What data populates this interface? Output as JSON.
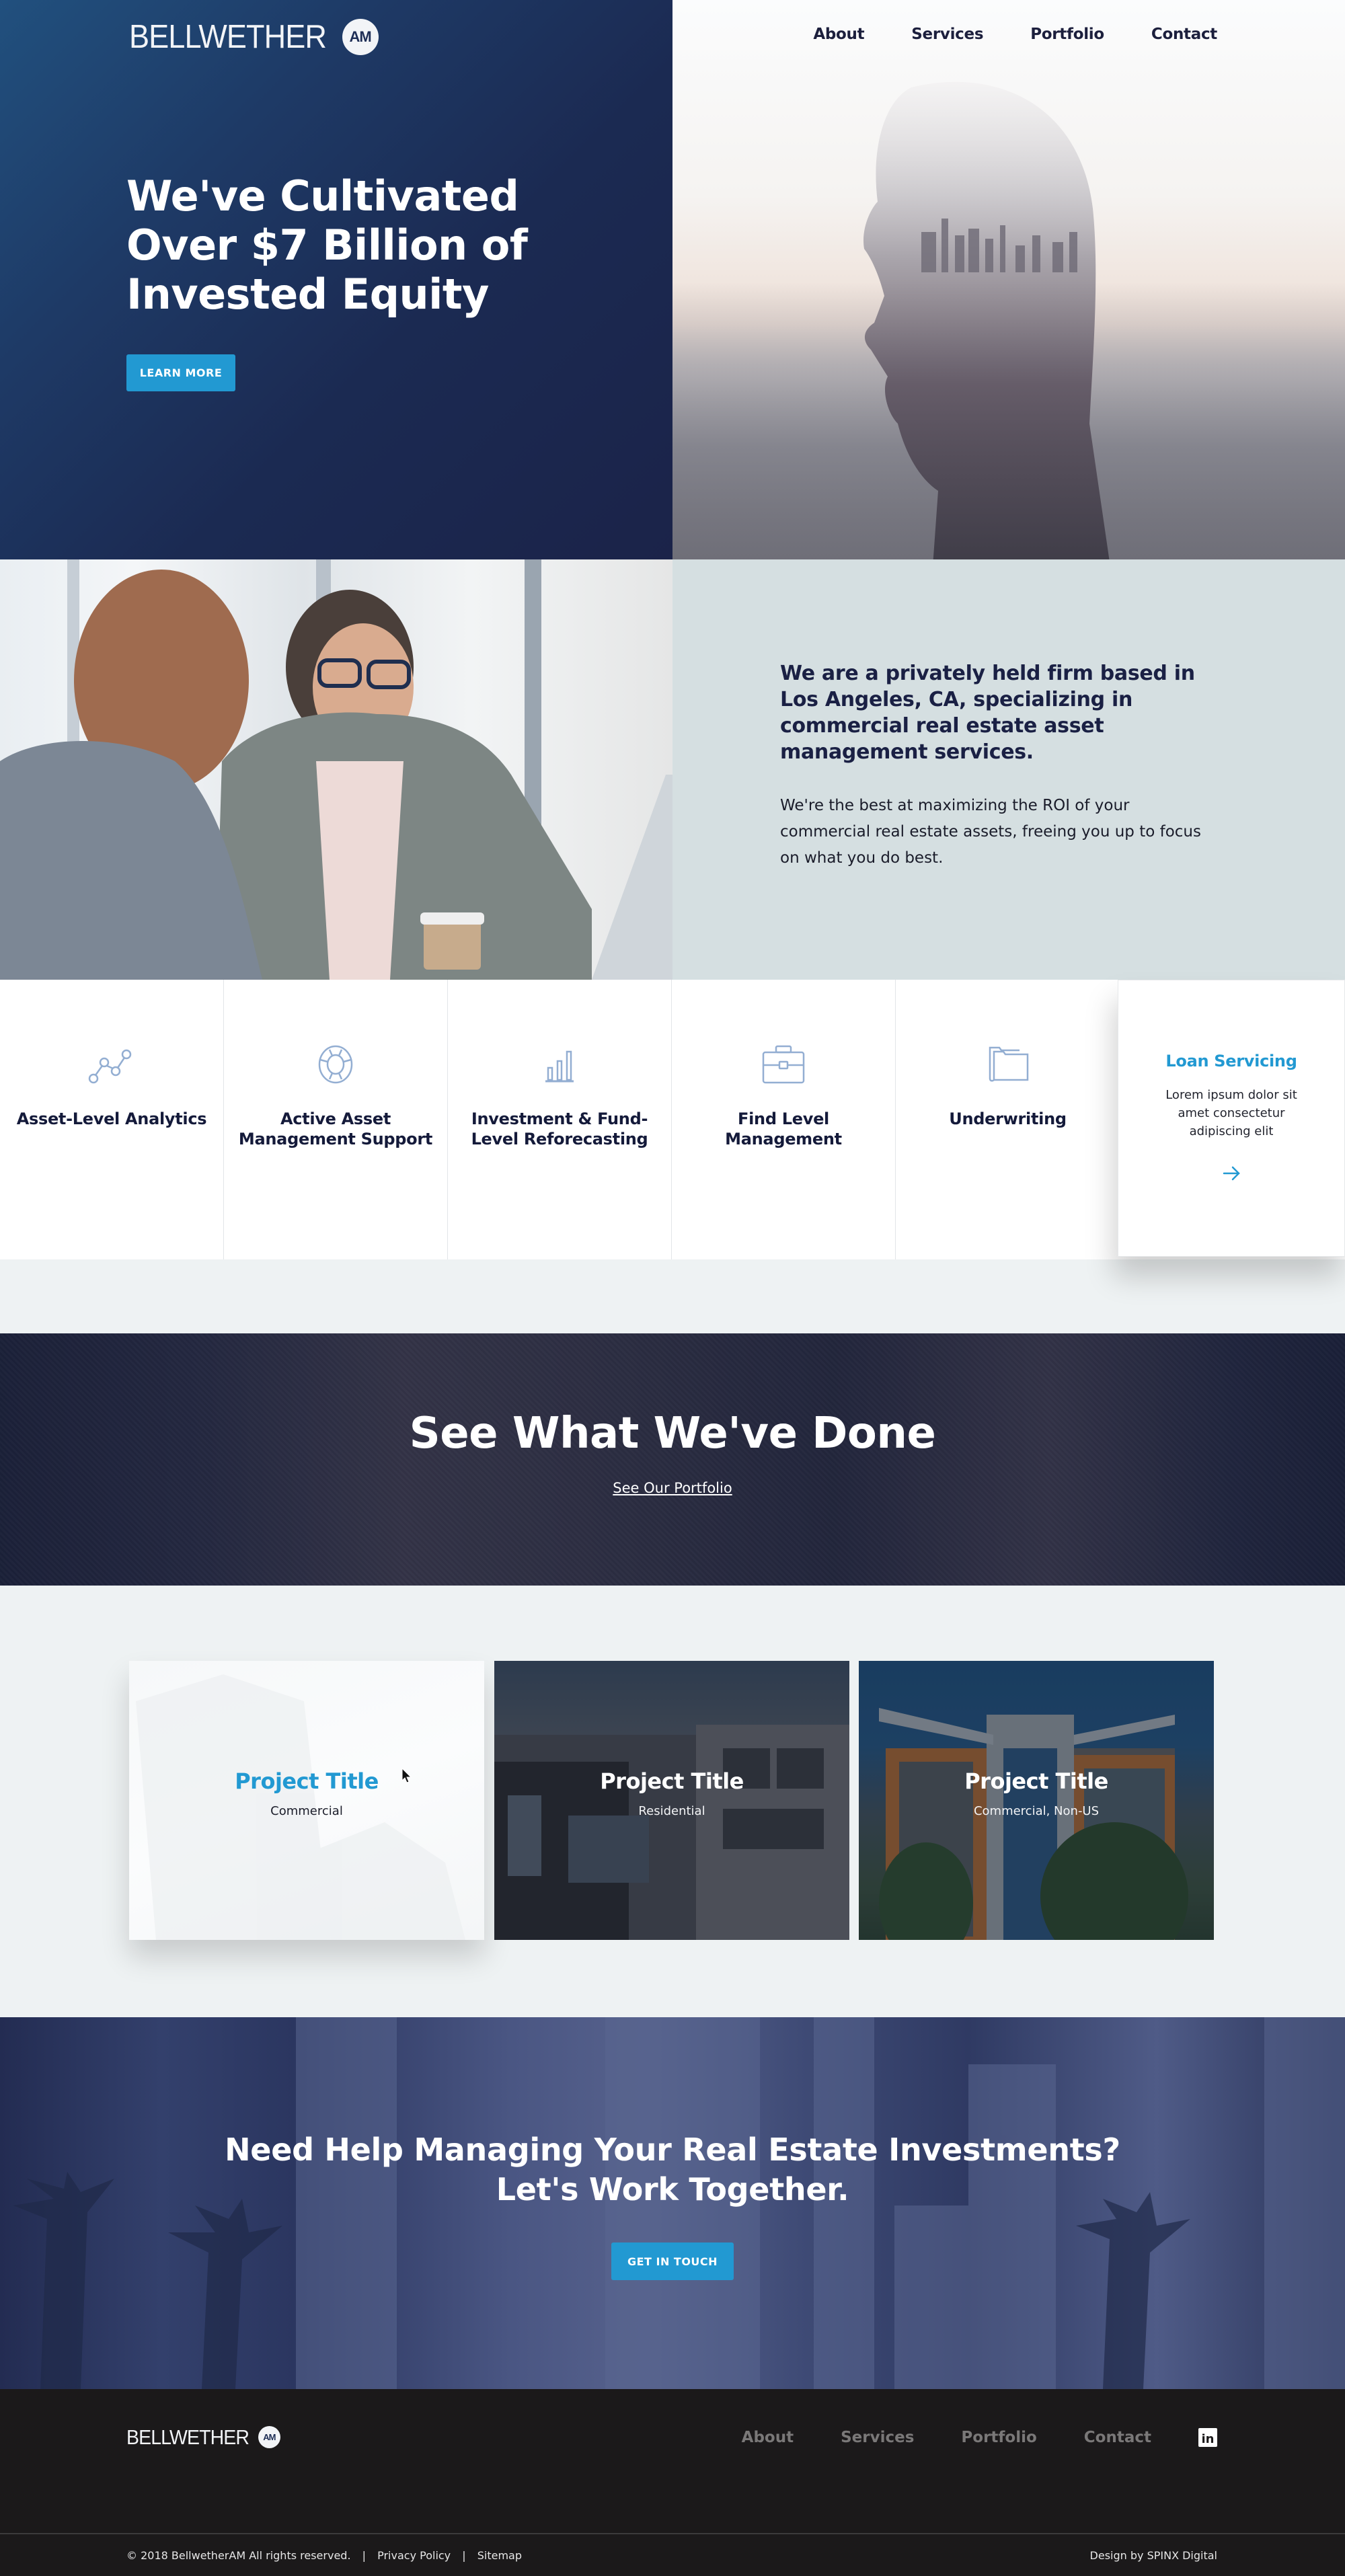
{
  "brand": {
    "name": "BELLWETHER",
    "badge": "AM"
  },
  "nav": {
    "items": [
      "About",
      "Services",
      "Portfolio",
      "Contact"
    ]
  },
  "hero": {
    "title": "We've Cultivated Over $7 Billion of Invested Equity",
    "cta_label": "LEARN MORE"
  },
  "about": {
    "heading": "We are a privately held firm based in Los Angeles, CA, specializing in commercial real estate asset management services.",
    "body": "We're the best at maximizing the ROI of your commercial real estate assets, freeing you up to focus on what you do best."
  },
  "services": {
    "items": [
      {
        "title": "Asset-Level Analytics",
        "icon": "analytics-line-icon"
      },
      {
        "title": "Active Asset Management Support",
        "icon": "lifebuoy-icon"
      },
      {
        "title": "Investment & Fund-Level Reforecasting",
        "icon": "bar-chart-icon"
      },
      {
        "title": "Find Level Management",
        "icon": "briefcase-icon"
      },
      {
        "title": "Underwriting",
        "icon": "folders-icon"
      }
    ],
    "active": {
      "title": "Loan Servicing",
      "description": "Lorem ipsum dolor sit amet consectetur adipiscing elit",
      "icon": "arrow-right-icon"
    }
  },
  "portfolio_banner": {
    "title": "See What We've Done",
    "link_label": "See Our Portfolio"
  },
  "projects": [
    {
      "title": "Project Title",
      "category": "Commercial"
    },
    {
      "title": "Project Title",
      "category": "Residential"
    },
    {
      "title": "Project Title",
      "category": "Commercial, Non-US"
    }
  ],
  "cta": {
    "title_line1": "Need Help Managing Your Real Estate Investments?",
    "title_line2": "Let's Work Together.",
    "button_label": "GET IN TOUCH"
  },
  "footer": {
    "nav": [
      "About",
      "Services",
      "Portfolio",
      "Contact"
    ],
    "social_icon": "linkedin-icon",
    "social_label": "in",
    "copyright": "© 2018 BellwetherAM All rights reserved.",
    "links": [
      "Privacy Policy",
      "Sitemap"
    ],
    "separator": "|",
    "credit": "Design by SPINX Digital"
  },
  "colors": {
    "navy": "#1b2349",
    "accent": "#2299d2",
    "about_panel": "#d5dfe1",
    "page_bg": "#eef2f3",
    "footer_bg": "#1b191a"
  }
}
